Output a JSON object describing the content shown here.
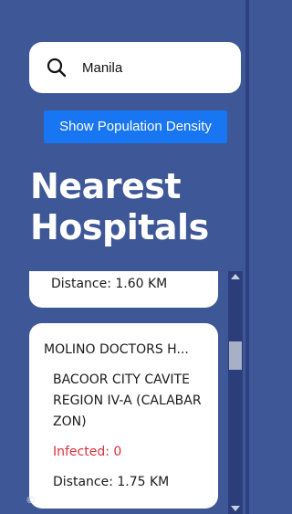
{
  "search": {
    "value": "Manila",
    "icon": "search-icon"
  },
  "toolbar": {
    "density_label": "Show Population Density"
  },
  "header": {
    "title": "Nearest Hospitals"
  },
  "hospitals": [
    {
      "distance": "Distance: 1.60 KM"
    },
    {
      "name": "MOLINO DOCTORS H...",
      "address": "BACOOR CITY CAVITE REGION IV-A (CALABAR ZON)",
      "infected": "Infected: 0",
      "distance": "Distance: 1.75 KM"
    }
  ],
  "colors": {
    "background": "#3e5797",
    "accent": "#1876f2",
    "infected": "#d9303a"
  },
  "footer": {
    "mark": "©"
  }
}
